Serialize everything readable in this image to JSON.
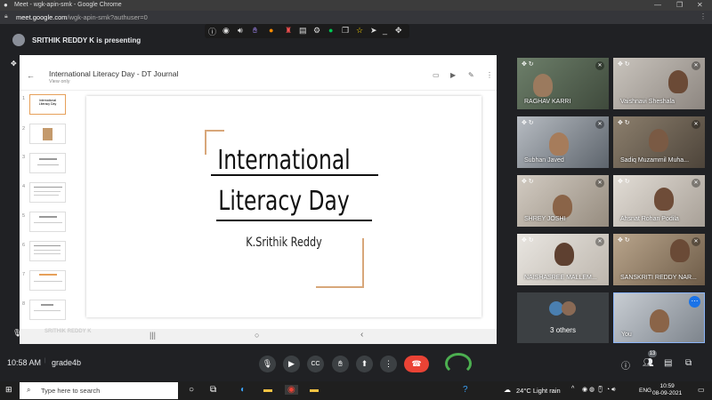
{
  "window": {
    "title": "Meet - wgk-apin-smk - Google Chrome",
    "url_host": "meet.google.com",
    "url_path": "/wgk-apin-smk?authuser=0"
  },
  "presentation_banner": {
    "text": "SRITHIK REDDY K is presenting"
  },
  "slides_app": {
    "doc_title": "International Literacy Day - DT Journal",
    "doc_subtitle": "View only",
    "thumb_numbers": [
      "1",
      "2",
      "3",
      "4",
      "5",
      "6",
      "7",
      "8"
    ],
    "current_slide": {
      "title_line1": "International",
      "title_line2": "Literacy Day",
      "author": "K.Srithik Reddy"
    },
    "presenter_overlay": "SRITHIK REDDY K"
  },
  "participants": [
    {
      "name": "RAGHAV KARRI"
    },
    {
      "name": "Vaishnavi Sheshala"
    },
    {
      "name": "Subhan Javed"
    },
    {
      "name": "Sadiq Muzammil Muha..."
    },
    {
      "name": "SHREY JOSHI"
    },
    {
      "name": "Ahsnat Rohan Podila"
    },
    {
      "name": "NAISHASREE MALLEM..."
    },
    {
      "name": "SANSKRITI REDDY NAR..."
    }
  ],
  "others_tile": {
    "label": "3 others"
  },
  "self_tile": {
    "label": "You"
  },
  "meeting": {
    "time": "10:58 AM",
    "name": "grade4b",
    "people_count": "13"
  },
  "taskbar": {
    "search_placeholder": "Type here to search",
    "weather": "24°C  Light rain",
    "lang": "ENG",
    "time": "10:59",
    "date": "08-09-2021"
  },
  "colors": {
    "meet_bg": "#202124",
    "end_call": "#ea4335",
    "slide_accent": "#d8a77a"
  }
}
